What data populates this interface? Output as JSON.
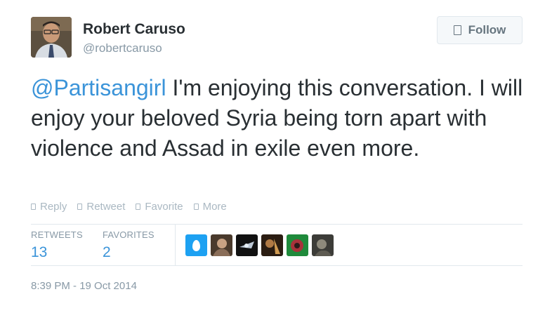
{
  "author": {
    "name": "Robert Caruso",
    "handle": "@robertcaruso"
  },
  "follow_label": "Follow",
  "tweet": {
    "mention": "@Partisangirl",
    "text": " I'm enjoying this conversation. I will enjoy your beloved Syria being torn apart with violence and Assad in exile even more."
  },
  "actions": [
    {
      "label": "Reply",
      "icon": "reply-icon"
    },
    {
      "label": "Retweet",
      "icon": "retweet-icon"
    },
    {
      "label": "Favorite",
      "icon": "favorite-icon"
    },
    {
      "label": "More",
      "icon": "more-icon"
    }
  ],
  "stats": {
    "retweets_label": "RETWEETS",
    "retweets_value": "13",
    "favorites_label": "FAVORITES",
    "favorites_value": "2"
  },
  "timestamp": "8:39 PM - 19 Oct 2014",
  "colors": {
    "link": "#3b94d9",
    "text": "#292f33",
    "muted": "#8899a6"
  }
}
